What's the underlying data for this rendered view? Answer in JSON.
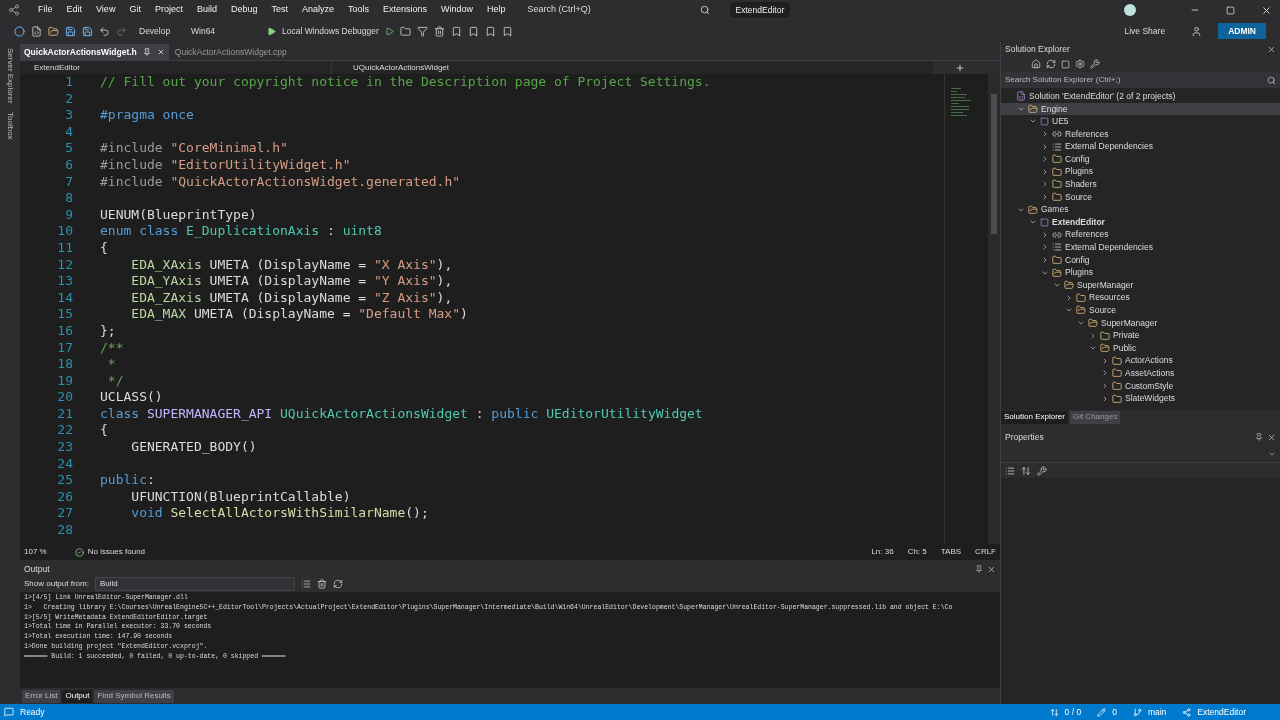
{
  "menu_bar": {
    "items": [
      "File",
      "Edit",
      "View",
      "Git",
      "Project",
      "Build",
      "Debug",
      "Test",
      "Analyze",
      "Tools",
      "Extensions",
      "Window",
      "Help"
    ],
    "search": "Search (Ctrl+Q)",
    "solution_name": "ExtendEditor"
  },
  "toolbar": {
    "configuration": "Develop",
    "platform": "Win64",
    "debugger": "Local Windows Debugger",
    "live_share": "Live Share",
    "account": "ADMIN"
  },
  "side_strip": [
    "Server Explorer",
    "Toolbox"
  ],
  "document_tabs": [
    {
      "label": "QuickActorActionsWidget.h",
      "selected": true
    },
    {
      "label": "QuickActorActionsWidget.cpp",
      "selected": false
    }
  ],
  "navigation": {
    "project": "ExtendEditor",
    "scope": "UQuickActorActionsWidget"
  },
  "code_lines": [
    {
      "number": "1",
      "tokens": [
        {
          "kind": "comment",
          "text": "// Fill out your copyright notice in the Description page of Project Settings."
        }
      ]
    },
    {
      "number": "2"
    },
    {
      "number": "3",
      "tokens": [
        {
          "kind": "keyword",
          "text": "#pragma once"
        }
      ]
    },
    {
      "number": "4"
    },
    {
      "number": "5",
      "tokens": [
        {
          "kind": "preprocessor",
          "text": "#include "
        },
        {
          "kind": "string",
          "text": "\"CoreMinimal.h\""
        }
      ]
    },
    {
      "number": "6",
      "tokens": [
        {
          "kind": "preprocessor",
          "text": "#include "
        },
        {
          "kind": "string",
          "text": "\"EditorUtilityWidget.h\""
        }
      ]
    },
    {
      "number": "7",
      "tokens": [
        {
          "kind": "preprocessor",
          "text": "#include "
        },
        {
          "kind": "string",
          "text": "\"QuickActorActionsWidget.generated.h\""
        }
      ]
    },
    {
      "number": "8"
    },
    {
      "number": "9",
      "tokens": [
        {
          "kind": "plain",
          "text": "UENUM(BlueprintType)"
        }
      ]
    },
    {
      "number": "10",
      "tokens": [
        {
          "kind": "keyword",
          "text": "enum class "
        },
        {
          "kind": "type",
          "text": "E_DuplicationAxis"
        },
        {
          "kind": "plain",
          "text": " : "
        },
        {
          "kind": "type",
          "text": "uint8"
        }
      ]
    },
    {
      "number": "11",
      "tokens": [
        {
          "kind": "plain",
          "text": "{"
        }
      ]
    },
    {
      "number": "12",
      "tokens": [
        {
          "kind": "member",
          "text": "    EDA_XAxis"
        },
        {
          "kind": "plain",
          "text": " UMETA (DisplayName = "
        },
        {
          "kind": "string",
          "text": "\"X Axis\""
        },
        {
          "kind": "plain",
          "text": "),"
        }
      ]
    },
    {
      "number": "13",
      "tokens": [
        {
          "kind": "member",
          "text": "    EDA_YAxis"
        },
        {
          "kind": "plain",
          "text": " UMETA (DisplayName = "
        },
        {
          "kind": "string",
          "text": "\"Y Axis\""
        },
        {
          "kind": "plain",
          "text": "),"
        }
      ]
    },
    {
      "number": "14",
      "tokens": [
        {
          "kind": "member",
          "text": "    EDA_ZAxis"
        },
        {
          "kind": "plain",
          "text": " UMETA (DisplayName = "
        },
        {
          "kind": "string",
          "text": "\"Z Axis\""
        },
        {
          "kind": "plain",
          "text": "),"
        }
      ]
    },
    {
      "number": "15",
      "tokens": [
        {
          "kind": "member",
          "text": "    EDA_MAX"
        },
        {
          "kind": "plain",
          "text": " UMETA (DisplayName = "
        },
        {
          "kind": "string",
          "text": "\"Default Max\""
        },
        {
          "kind": "plain",
          "text": ")"
        }
      ]
    },
    {
      "number": "16",
      "tokens": [
        {
          "kind": "plain",
          "text": "};"
        }
      ]
    },
    {
      "number": "17",
      "tokens": [
        {
          "kind": "comment",
          "text": "/**"
        }
      ]
    },
    {
      "number": "18",
      "tokens": [
        {
          "kind": "comment",
          "text": " *"
        }
      ]
    },
    {
      "number": "19",
      "tokens": [
        {
          "kind": "comment",
          "text": " */"
        }
      ]
    },
    {
      "number": "20",
      "tokens": [
        {
          "kind": "plain",
          "text": "UCLASS()"
        }
      ]
    },
    {
      "number": "21",
      "tokens": [
        {
          "kind": "keyword",
          "text": "class "
        },
        {
          "kind": "macro",
          "text": "SUPERMANAGER_API "
        },
        {
          "kind": "type",
          "text": "UQuickActorActionsWidget"
        },
        {
          "kind": "plain",
          "text": " : "
        },
        {
          "kind": "keyword",
          "text": "public "
        },
        {
          "kind": "type",
          "text": "UEditorUtilityWidget"
        }
      ]
    },
    {
      "number": "22",
      "tokens": [
        {
          "kind": "plain",
          "text": "{"
        }
      ]
    },
    {
      "number": "23",
      "tokens": [
        {
          "kind": "plain",
          "text": "    GENERATED_BODY()"
        }
      ]
    },
    {
      "number": "24"
    },
    {
      "number": "25",
      "tokens": [
        {
          "kind": "keyword",
          "text": "public"
        },
        {
          "kind": "plain",
          "text": ":"
        }
      ]
    },
    {
      "number": "26",
      "tokens": [
        {
          "kind": "plain",
          "text": "    UFUNCTION(BlueprintCallable)"
        }
      ]
    },
    {
      "number": "27",
      "tokens": [
        {
          "kind": "keyword",
          "text": "    void "
        },
        {
          "kind": "function",
          "text": "SelectAllActorsWithSimilarName"
        },
        {
          "kind": "plain",
          "text": "();"
        }
      ]
    },
    {
      "number": "28"
    }
  ],
  "editor_status": {
    "zoom": "107 %",
    "issues": "No issues found",
    "line": "Ln: 36",
    "column": "Ch: 5",
    "indent": "TABS",
    "line_ending": "CRLF"
  },
  "output": {
    "title": "Output",
    "source_label": "Show output from:",
    "source": "Build",
    "lines": [
      "1>[4/5] Link UnrealEditor-SuperManager.dll",
      "1>   Creating library E:\\Courses\\UnrealEngine5C++_EditorTool\\Projects\\ActualProject\\ExtendEditor\\Plugins\\SuperManager\\Intermediate\\Build\\Win64\\UnrealEditor\\Development\\SuperManager\\UnrealEditor-SuperManager.suppressed.lib and object E:\\Co",
      "1>[5/5] WriteMetadata ExtendEditorEditor.target",
      "1>Total time in Parallel executor: 33.70 seconds",
      "1>Total execution time: 147.90 seconds",
      "1>Done building project \"ExtendEditor.vcxproj\".",
      "══════ Build: 1 succeeded, 0 failed, 0 up-to-date, 0 skipped ══════"
    ]
  },
  "bottom_tabs": [
    {
      "label": "Error List",
      "selected": false
    },
    {
      "label": "Output",
      "selected": true
    },
    {
      "label": "Find Symbol Results",
      "selected": false
    }
  ],
  "solution_explorer": {
    "title": "Solution Explorer",
    "search_placeholder": "Search Solution Explorer (Ctrl+;)",
    "tree": [
      {
        "label": "Solution 'ExtendEditor' (2 of 2 projects)",
        "kind": "solution",
        "selected": false,
        "children": [
          {
            "label": "Engine",
            "kind": "folder",
            "expanded": true,
            "selected": true,
            "children": [
              {
                "label": "UE5",
                "kind": "project",
                "startup": false,
                "expanded": true,
                "selected": false,
                "children": [
                  {
                    "label": "References",
                    "kind": "references",
                    "expanded": false,
                    "selected": false
                  },
                  {
                    "label": "External Dependencies",
                    "kind": "dependencies",
                    "expanded": false,
                    "selected": false
                  },
                  {
                    "label": "Config",
                    "kind": "filter",
                    "expanded": false,
                    "selected": false
                  },
                  {
                    "label": "Plugins",
                    "kind": "filter",
                    "expanded": false,
                    "selected": false
                  },
                  {
                    "label": "Shaders",
                    "kind": "filter",
                    "expanded": false,
                    "selected": false
                  },
                  {
                    "label": "Source",
                    "kind": "filter",
                    "expanded": false,
                    "selected": false
                  }
                ]
              }
            ]
          },
          {
            "label": "Games",
            "kind": "folder",
            "expanded": true,
            "selected": false,
            "children": [
              {
                "label": "ExtendEditor",
                "kind": "project",
                "startup": true,
                "expanded": true,
                "selected": false,
                "children": [
                  {
                    "label": "References",
                    "kind": "references",
                    "expanded": false,
                    "selected": false
                  },
                  {
                    "label": "External Dependencies",
                    "kind": "dependencies",
                    "expanded": false,
                    "selected": false
                  },
                  {
                    "label": "Config",
                    "kind": "filter",
                    "expanded": false,
                    "selected": false
                  },
                  {
                    "label": "Plugins",
                    "kind": "filter",
                    "expanded": true,
                    "selected": false,
                    "children": [
                      {
                        "label": "SuperManager",
                        "kind": "filter",
                        "expanded": true,
                        "selected": false,
                        "children": [
                          {
                            "label": "Resources",
                            "kind": "filter",
                            "expanded": false,
                            "selected": false
                          },
                          {
                            "label": "Source",
                            "kind": "filter",
                            "expanded": true,
                            "selected": false,
                            "children": [
                              {
                                "label": "SuperManager",
                                "kind": "filter",
                                "expanded": true,
                                "selected": false,
                                "children": [
                                  {
                                    "label": "Private",
                                    "kind": "filter",
                                    "expanded": false,
                                    "selected": false
                                  },
                                  {
                                    "label": "Public",
                                    "kind": "filter",
                                    "expanded": true,
                                    "selected": false,
                                    "children": [
                                      {
                                        "label": "ActorActions",
                                        "kind": "filter",
                                        "expanded": false,
                                        "selected": false
                                      },
                                      {
                                        "label": "AssetActions",
                                        "kind": "filter",
                                        "expanded": false,
                                        "selected": false
                                      },
                                      {
                                        "label": "CustomStyle",
                                        "kind": "filter",
                                        "expanded": false,
                                        "selected": false
                                      },
                                      {
                                        "label": "SlateWidgets",
                                        "kind": "filter",
                                        "expanded": false,
                                        "selected": false
                                      }
                                    ]
                                  }
                                ]
                              }
                            ]
                          }
                        ]
                      }
                    ]
                  }
                ]
              }
            ]
          }
        ]
      }
    ],
    "tabs": [
      {
        "label": "Solution Explorer",
        "selected": true
      },
      {
        "label": "Git Changes",
        "selected": false
      }
    ]
  },
  "properties": {
    "title": "Properties"
  },
  "status_bar": {
    "state": "Ready",
    "changes": "0 / 0",
    "edits": "0",
    "branch": "main",
    "repository": "ExtendEditor"
  }
}
